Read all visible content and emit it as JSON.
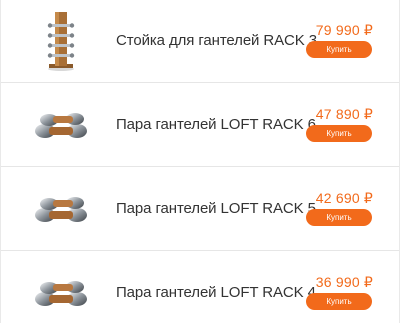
{
  "products": [
    {
      "name": "Стойка для гантелей RACK 3",
      "price": "79 990 ₽",
      "button": "Купить",
      "image": "wooden-dumbbell-rack"
    },
    {
      "name": "Пара гантелей LOFT RACK 6",
      "price": "47 890 ₽",
      "button": "Купить",
      "image": "chrome-wood-dumbbells"
    },
    {
      "name": "Пара гантелей LOFT RACK 5",
      "price": "42 690 ₽",
      "button": "Купить",
      "image": "chrome-wood-dumbbells"
    },
    {
      "name": "Пара гантелей LOFT RACK 4",
      "price": "36 990 ₽",
      "button": "Купить",
      "image": "chrome-wood-dumbbells"
    }
  ],
  "colors": {
    "accent": "#f26a1b",
    "text": "#333333",
    "divider": "#e6e6e6"
  }
}
